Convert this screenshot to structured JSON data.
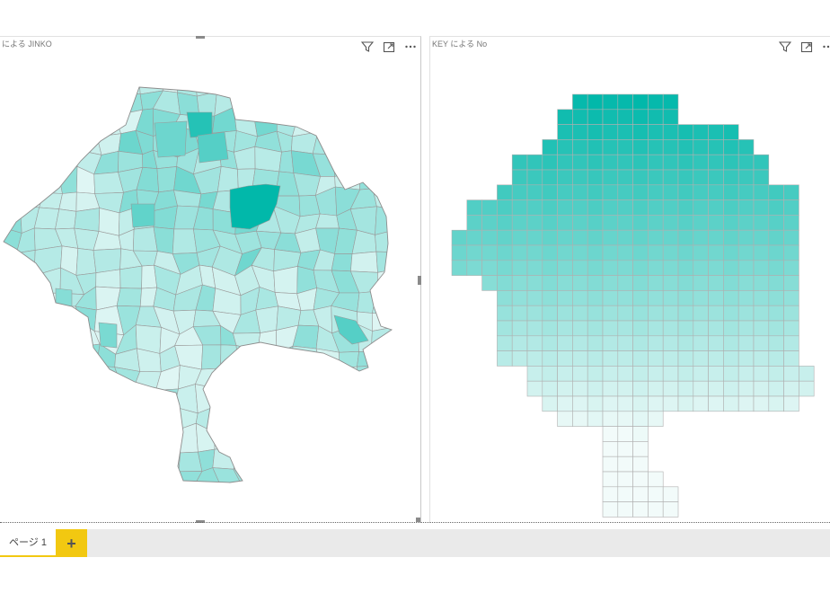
{
  "left_visual": {
    "title": "による JINKO"
  },
  "right_visual": {
    "title": "KEY による No"
  },
  "icons": {
    "filter": "filter-icon",
    "focus": "focus-mode-icon",
    "more": "more-options-icon",
    "add": "plus-icon"
  },
  "page_tabs": {
    "tabs": [
      "ページ 1"
    ],
    "add_label": "+"
  },
  "colors": {
    "accent": "#01b8aa",
    "light": "#f2fbfa",
    "tab_accent": "#f2c811",
    "tab_bar": "#eaeaea"
  }
}
